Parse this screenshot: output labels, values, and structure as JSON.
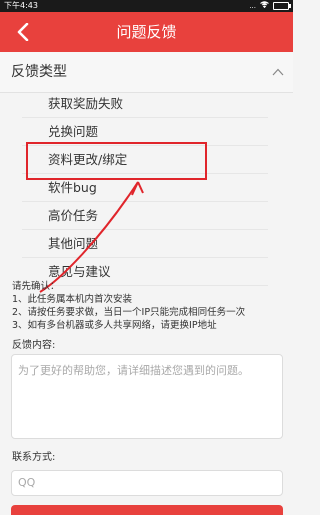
{
  "status_bar": {
    "time": "下午4:43",
    "signal": "...",
    "colors": {
      "bg": "#1a1a1a"
    }
  },
  "navbar": {
    "title": "问题反馈",
    "accent": "#e8413d",
    "back_icon": "chevron-left-icon"
  },
  "section": {
    "title": "反馈类型",
    "toggle_icon": "chevron-up-icon"
  },
  "feedback_types": [
    {
      "label": "获取奖励失败"
    },
    {
      "label": "兑换问题"
    },
    {
      "label": "资料更改/绑定",
      "highlighted": true
    },
    {
      "label": "软件bug"
    },
    {
      "label": "高价任务"
    },
    {
      "label": "其他问题"
    },
    {
      "label": "意见与建议"
    }
  ],
  "notice": {
    "title": "请先确认：",
    "lines": [
      "1、此任务属本机内首次安装",
      "2、请按任务要求做，当日一个IP只能完成相同任务一次",
      "3、如有多台机器或多人共享网络，请更换IP地址"
    ]
  },
  "content": {
    "label": "反馈内容:",
    "placeholder": "为了更好的帮助您，请详细描述您遇到的问题。"
  },
  "contact": {
    "label": "联系方式:",
    "placeholder": "QQ"
  },
  "annotation_color": "#e0252b"
}
